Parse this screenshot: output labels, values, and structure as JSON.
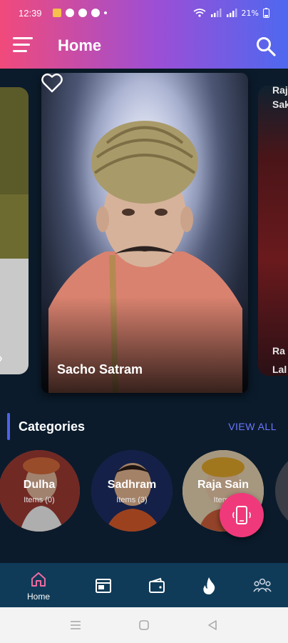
{
  "status_bar": {
    "time": "12:39",
    "battery": "21%"
  },
  "header": {
    "title": "Home",
    "menu_icon": "hamburger-menu-icon",
    "search_icon": "search-icon",
    "gradient": [
      "#f14a7b",
      "#9b4fd6",
      "#4e68f0"
    ]
  },
  "carousel": {
    "featured": {
      "title": "Sacho Satram",
      "favorite_icon": "heart-outline-icon"
    },
    "right_partial_text_top": "Raj\nSak",
    "right_partial_text_bottom": "Ra\nLal"
  },
  "categories": {
    "heading": "Categories",
    "view_all": "VIEW ALL",
    "accent_color": "#4d63e8",
    "items": [
      {
        "name": "Dulha",
        "count": "Items (0)"
      },
      {
        "name": "Sadhram",
        "count": "Items (3)"
      },
      {
        "name": "Raja Sain",
        "count": "Items"
      }
    ]
  },
  "fab": {
    "icon": "phone-icon",
    "color": "#f0397a"
  },
  "bottom_nav": {
    "items": [
      {
        "label": "Home",
        "icon": "home-icon",
        "active": true
      },
      {
        "label": "",
        "icon": "film-icon"
      },
      {
        "label": "",
        "icon": "wallet-icon"
      },
      {
        "label": "",
        "icon": "fire-icon"
      },
      {
        "label": "",
        "icon": "group-icon"
      }
    ],
    "background": "#0f3b58"
  },
  "system_nav": {
    "icons": [
      "recent-apps-icon",
      "home-circle-icon",
      "back-icon"
    ]
  }
}
